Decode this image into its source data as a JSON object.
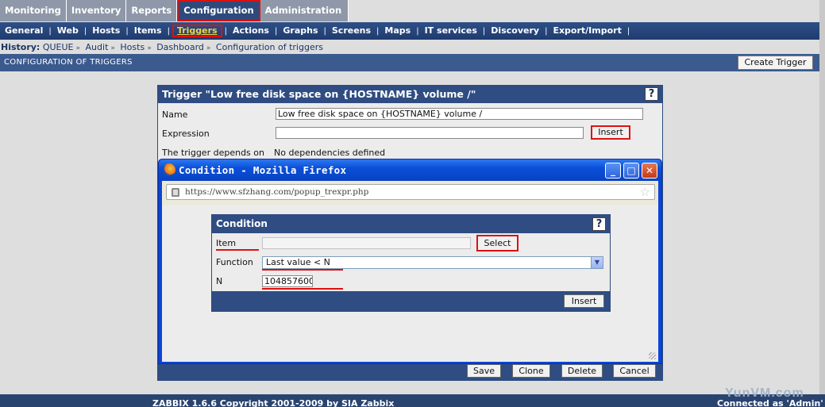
{
  "main_tabs": [
    "Monitoring",
    "Inventory",
    "Reports",
    "Configuration",
    "Administration"
  ],
  "sub_menu": [
    "General",
    "Web",
    "Hosts",
    "Items",
    "Triggers",
    "Actions",
    "Graphs",
    "Screens",
    "Maps",
    "IT services",
    "Discovery",
    "Export/Import"
  ],
  "history": {
    "label": "History:",
    "items": [
      "QUEUE",
      "Audit",
      "Hosts",
      "Dashboard",
      "Configuration of triggers"
    ]
  },
  "page_title": "CONFIGURATION OF TRIGGERS",
  "create_trigger_label": "Create Trigger",
  "trigger_form": {
    "title": "Trigger \"Low free disk space on {HOSTNAME} volume /\"",
    "help": "?",
    "name_label": "Name",
    "name_value": "Low free disk space on {HOSTNAME} volume /",
    "expression_label": "Expression",
    "expression_value": "",
    "insert_label": "Insert",
    "depends_label": "The trigger depends on",
    "depends_value": "No dependencies defined",
    "save_label": "Save",
    "clone_label": "Clone",
    "delete_label": "Delete",
    "cancel_label": "Cancel"
  },
  "popup": {
    "window_title": "Condition - Mozilla Firefox",
    "url": "https://www.sfzhang.com/popup_trexpr.php",
    "minimize": "_",
    "maximize": "□",
    "close": "✕",
    "condition": {
      "title": "Condition",
      "help": "?",
      "item_label": "Item",
      "item_value": "",
      "select_label": "Select",
      "function_label": "Function",
      "function_value": "Last value < N",
      "n_label": "N",
      "n_value": "104857600",
      "insert_label": "Insert"
    }
  },
  "footer": {
    "copyright": "ZABBIX 1.6.6 Copyright 2001-2009 by SIA Zabbix",
    "connected": "Connected as 'Admin'"
  },
  "watermark": "YunVM.com",
  "colors": {
    "header_blue": "#2f4d82",
    "highlight_red": "#dd1111",
    "active_submenu": "#f5d040"
  }
}
